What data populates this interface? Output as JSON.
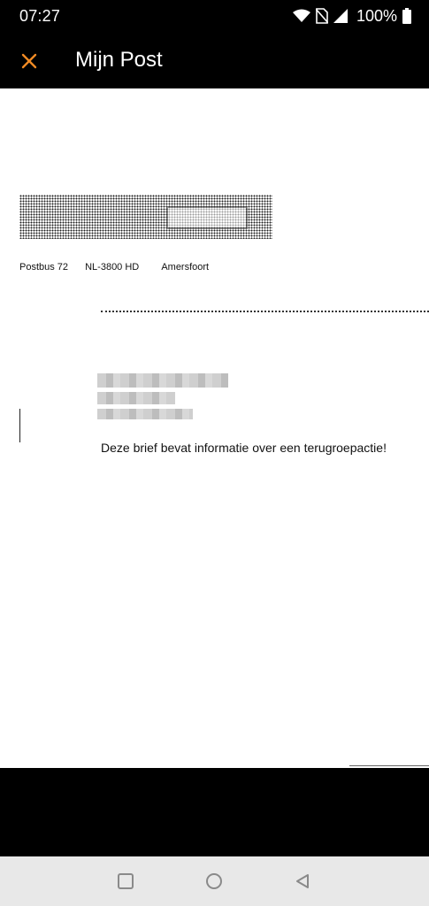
{
  "status_bar": {
    "time": "07:27",
    "battery": "100%",
    "icons": [
      "wifi-icon",
      "no-sim-icon",
      "signal-icon",
      "battery-icon"
    ]
  },
  "app_bar": {
    "title": "Mijn Post",
    "close_icon": "close-icon",
    "accent_color": "#f08a24"
  },
  "document": {
    "sender_address": {
      "postbus": "Postbus 72",
      "postcode": "NL-3800 HD",
      "city": "Amersfoort"
    },
    "notice": "Deze brief bevat informatie over een terugroepactie!"
  },
  "nav_bar": {
    "icons": [
      "recents-icon",
      "home-icon",
      "back-icon"
    ]
  }
}
